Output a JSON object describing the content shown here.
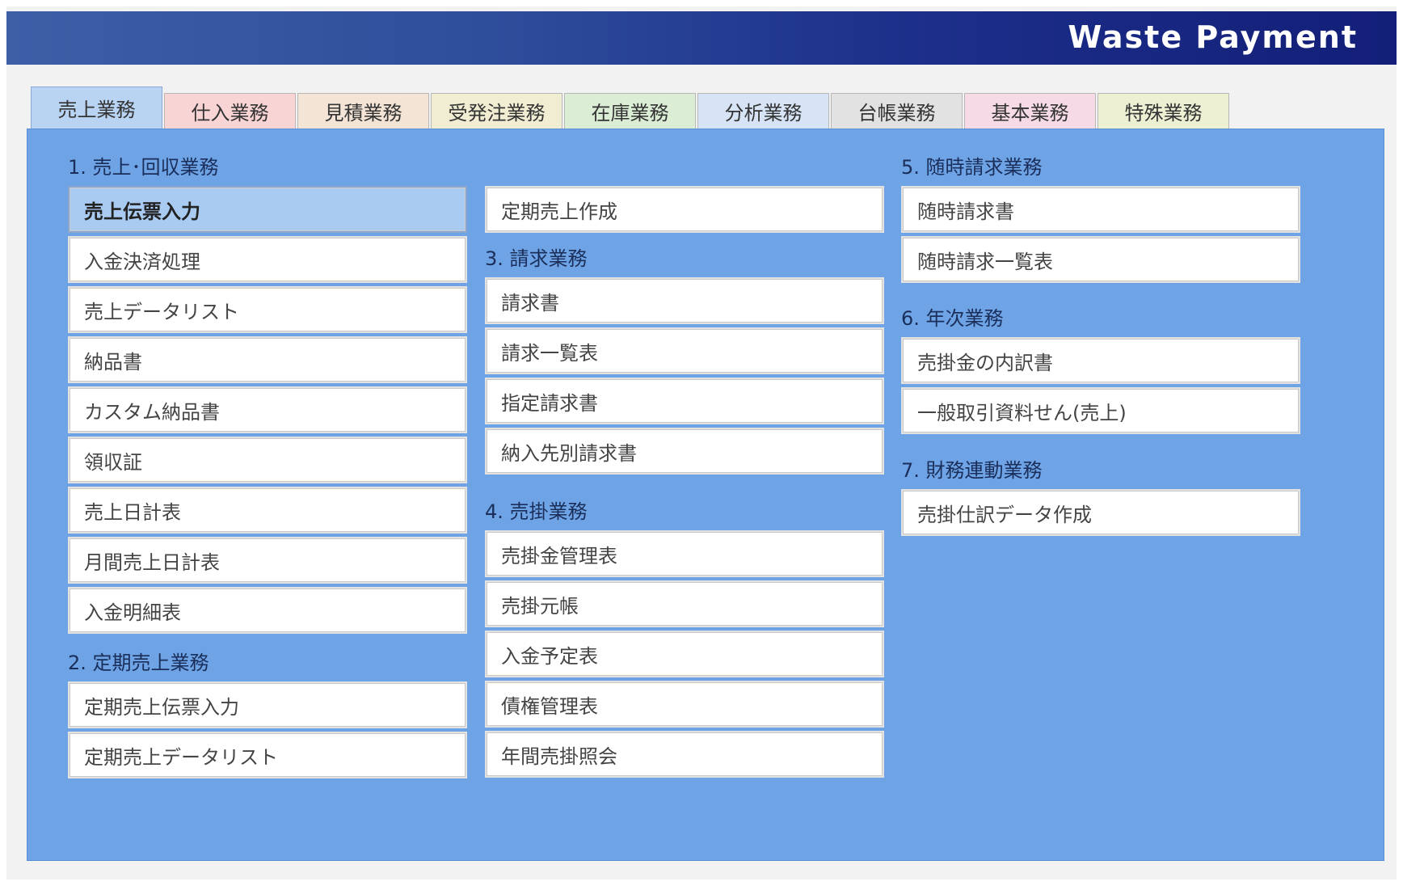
{
  "app_title": "Waste Payment",
  "tabs": [
    {
      "label": "売上業務",
      "color": "#b9d3f2"
    },
    {
      "label": "仕入業務",
      "color": "#f9d4d4"
    },
    {
      "label": "見積業務",
      "color": "#f3e4d6"
    },
    {
      "label": "受発注業務",
      "color": "#f0edd2"
    },
    {
      "label": "在庫業務",
      "color": "#dcedd6"
    },
    {
      "label": "分析業務",
      "color": "#d6e4f5"
    },
    {
      "label": "台帳業務",
      "color": "#e2e2e2"
    },
    {
      "label": "基本業務",
      "color": "#f6dbe6"
    },
    {
      "label": "特殊業務",
      "color": "#eef0d4"
    }
  ],
  "sections": {
    "s1": {
      "title": "1. 売上･回収業務",
      "items": [
        "売上伝票入力",
        "入金決済処理",
        "売上データリスト",
        "納品書",
        "カスタム納品書",
        "領収証",
        "売上日計表",
        "月間売上日計表",
        "入金明細表"
      ]
    },
    "s2": {
      "title": "2. 定期売上業務",
      "items": [
        "定期売上伝票入力",
        "定期売上データリスト",
        "定期売上作成"
      ]
    },
    "s3": {
      "title": "3. 請求業務",
      "items": [
        "請求書",
        "請求一覧表",
        "指定請求書",
        "納入先別請求書"
      ]
    },
    "s4": {
      "title": "4. 売掛業務",
      "items": [
        "売掛金管理表",
        "売掛元帳",
        "入金予定表",
        "債権管理表",
        "年間売掛照会"
      ]
    },
    "s5": {
      "title": "5. 随時請求業務",
      "items": [
        "随時請求書",
        "随時請求一覧表"
      ]
    },
    "s6": {
      "title": "6. 年次業務",
      "items": [
        "売掛金の内訳書",
        "一般取引資料せん(売上)"
      ]
    },
    "s7": {
      "title": "7. 財務連動業務",
      "items": [
        "売掛仕訳データ作成"
      ]
    }
  },
  "colors": {
    "header": "#1c2f8a",
    "panel": "#6ea4e6",
    "selected_item": "#a9cbf2"
  }
}
